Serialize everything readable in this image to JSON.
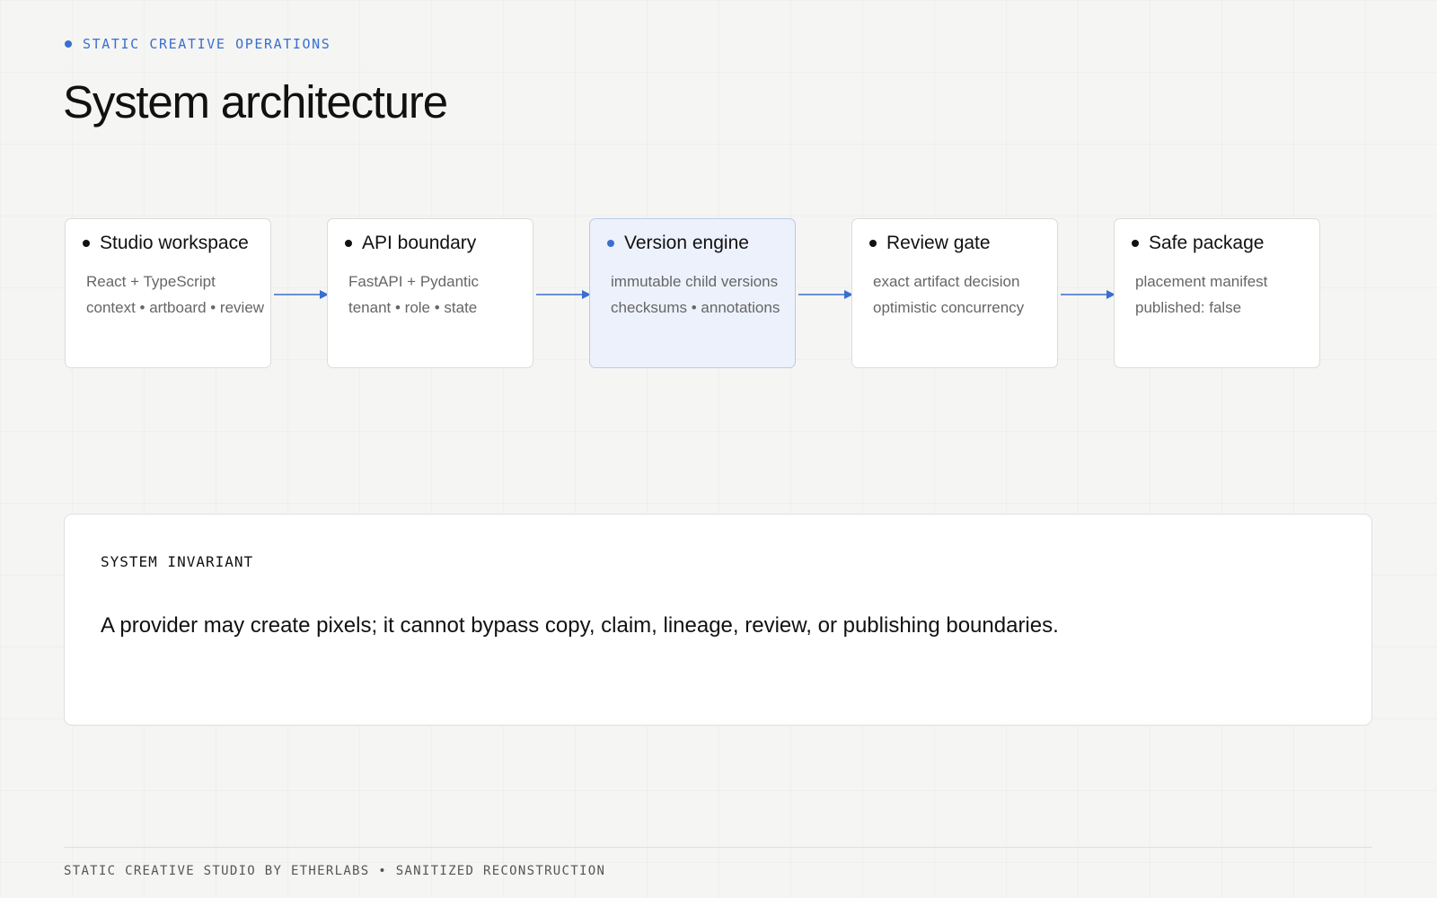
{
  "header": {
    "eyebrow": "STATIC CREATIVE OPERATIONS",
    "title": "System architecture"
  },
  "flow": {
    "accent_color": "#3a6fd0",
    "highlight_fill": "#edf1fb",
    "nodes": [
      {
        "title": "Studio workspace",
        "lines": [
          "React + TypeScript",
          "context • artboard • review"
        ],
        "highlighted": false
      },
      {
        "title": "API boundary",
        "lines": [
          "FastAPI + Pydantic",
          "tenant • role • state"
        ],
        "highlighted": false
      },
      {
        "title": "Version engine",
        "lines": [
          "immutable child versions",
          "checksums • annotations"
        ],
        "highlighted": true
      },
      {
        "title": "Review gate",
        "lines": [
          "exact artifact decision",
          "optimistic concurrency"
        ],
        "highlighted": false
      },
      {
        "title": "Safe package",
        "lines": [
          "placement manifest",
          "published: false"
        ],
        "highlighted": false
      }
    ]
  },
  "invariant": {
    "label": "SYSTEM INVARIANT",
    "text": "A provider may create pixels; it cannot bypass copy, claim, lineage, review, or publishing boundaries."
  },
  "footer": {
    "text": "STATIC CREATIVE STUDIO BY ETHERLABS • SANITIZED RECONSTRUCTION"
  }
}
